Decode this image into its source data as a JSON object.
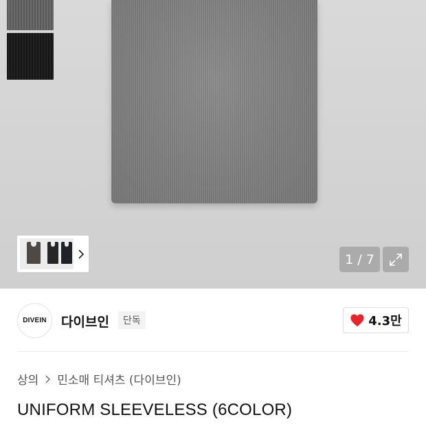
{
  "gallery": {
    "counter": "1 / 7",
    "swatches": [
      "gray-ribbed",
      "black-ribbed"
    ],
    "thumbnail_chevron_icon": "chevron-right-icon",
    "expand_icon": "expand-arrows-icon"
  },
  "brand": {
    "logo_text": "DIVEIN",
    "name": "다이브인",
    "badge": "단독",
    "likes": "4.3만",
    "like_icon": "heart-icon",
    "like_color": "#e8242b"
  },
  "category": {
    "crumbs": [
      "상의",
      "민소매 티셔츠 (다이브인)"
    ],
    "separator_icon": "chevron-right-icon"
  },
  "product": {
    "title": "UNIFORM SLEEVELESS (6COLOR)"
  }
}
